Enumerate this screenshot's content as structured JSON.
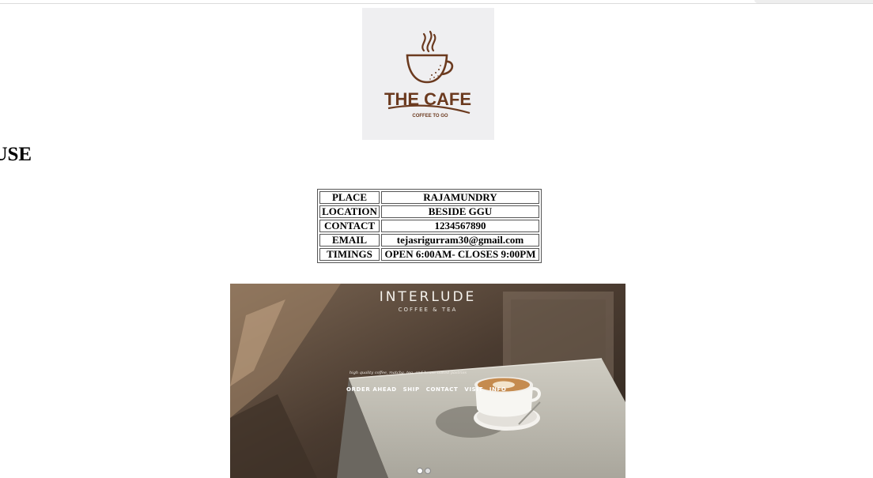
{
  "logo": {
    "title": "THE CAFE",
    "subtitle": "COFFEE TO GO",
    "icon": "coffee-cup-icon",
    "brand_color": "#6b3a1f"
  },
  "page": {
    "heading": "OUSE"
  },
  "info_table": {
    "rows": [
      {
        "label": "PLACE",
        "value": "RAJAMUNDRY"
      },
      {
        "label": "LOCATION",
        "value": "BESIDE GGU"
      },
      {
        "label": "CONTACT",
        "value": "1234567890"
      },
      {
        "label": "EMAIL",
        "value": "tejasrigurram30@gmail.com"
      },
      {
        "label": "TIMINGS",
        "value": "OPEN 6:00AM- CLOSES 9:00PM"
      }
    ]
  },
  "hero": {
    "brand": "INTERLUDE",
    "subtitle": "COFFEE & TEA",
    "tagline": "high quality coffee, matcha, tea, and house-baked pastries",
    "nav": [
      "ORDER AHEAD",
      "SHIP",
      "CONTACT",
      "VISIT",
      "INFO"
    ]
  }
}
